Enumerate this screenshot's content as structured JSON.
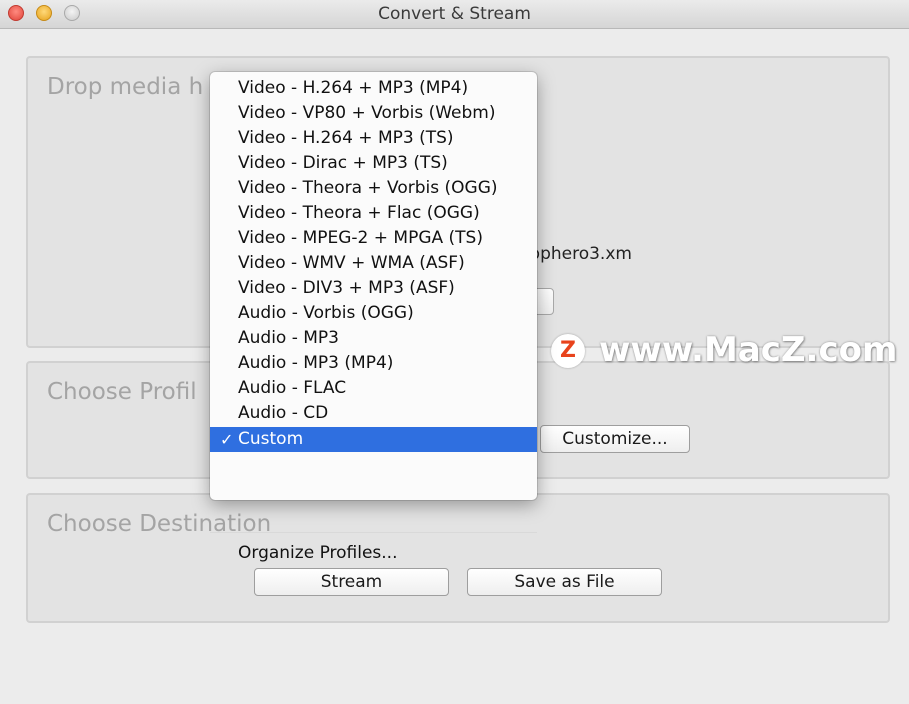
{
  "window": {
    "title": "Convert & Stream"
  },
  "sections": {
    "drop_media_title": "Drop media h",
    "choose_profile_title": "Choose Profil",
    "choose_destination_title": "Choose Destination"
  },
  "drop_media": {
    "file_name": "sapphero3.xm"
  },
  "profile": {
    "customize_label": "Customize..."
  },
  "destination": {
    "stream_label": "Stream",
    "save_as_file_label": "Save as File"
  },
  "profile_menu": {
    "items": [
      "Video - H.264 + MP3 (MP4)",
      "Video - VP80 + Vorbis (Webm)",
      "Video - H.264 + MP3 (TS)",
      "Video - Dirac + MP3 (TS)",
      "Video - Theora + Vorbis (OGG)",
      "Video - Theora + Flac (OGG)",
      "Video - MPEG-2 + MPGA (TS)",
      "Video - WMV + WMA (ASF)",
      "Video - DIV3 + MP3 (ASF)",
      "Audio - Vorbis (OGG)",
      "Audio - MP3",
      "Audio - MP3 (MP4)",
      "Audio - FLAC",
      "Audio - CD",
      "Custom"
    ],
    "selected": "Custom",
    "checkmark": "✓",
    "organize_label": "Organize Profiles..."
  },
  "watermark": {
    "badge": "Z",
    "text": "www.MacZ.com"
  },
  "colors": {
    "selection": "#2f6fe0",
    "window_bg": "#ececec"
  }
}
